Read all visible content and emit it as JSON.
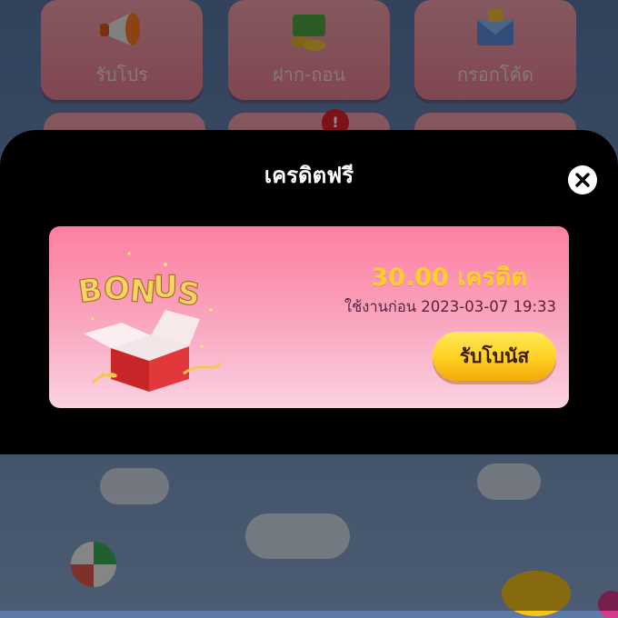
{
  "background": {
    "tiles": [
      {
        "label": "รับโปร",
        "icon": "megaphone-icon"
      },
      {
        "label": "ฝาก-ถอน",
        "icon": "money-stack-icon"
      },
      {
        "label": "กรอกโค้ด",
        "icon": "gift-envelope-icon"
      }
    ],
    "badge": "!"
  },
  "modal": {
    "title": "เครดิตฟรี",
    "close_icon": "close-icon",
    "bonus_card": {
      "image_icon": "bonus-gift-box-icon",
      "amount": "30.00 เครดิต",
      "expiry": "ใช้งานก่อน 2023-03-07 19:33",
      "claim_label": "รับโบนัส"
    }
  },
  "colors": {
    "card_top": "#ff7ea0",
    "card_bottom": "#fbd2e2",
    "amount": "#ffd02a",
    "button": "#ffcf1f",
    "modal_bg": "#000000"
  }
}
